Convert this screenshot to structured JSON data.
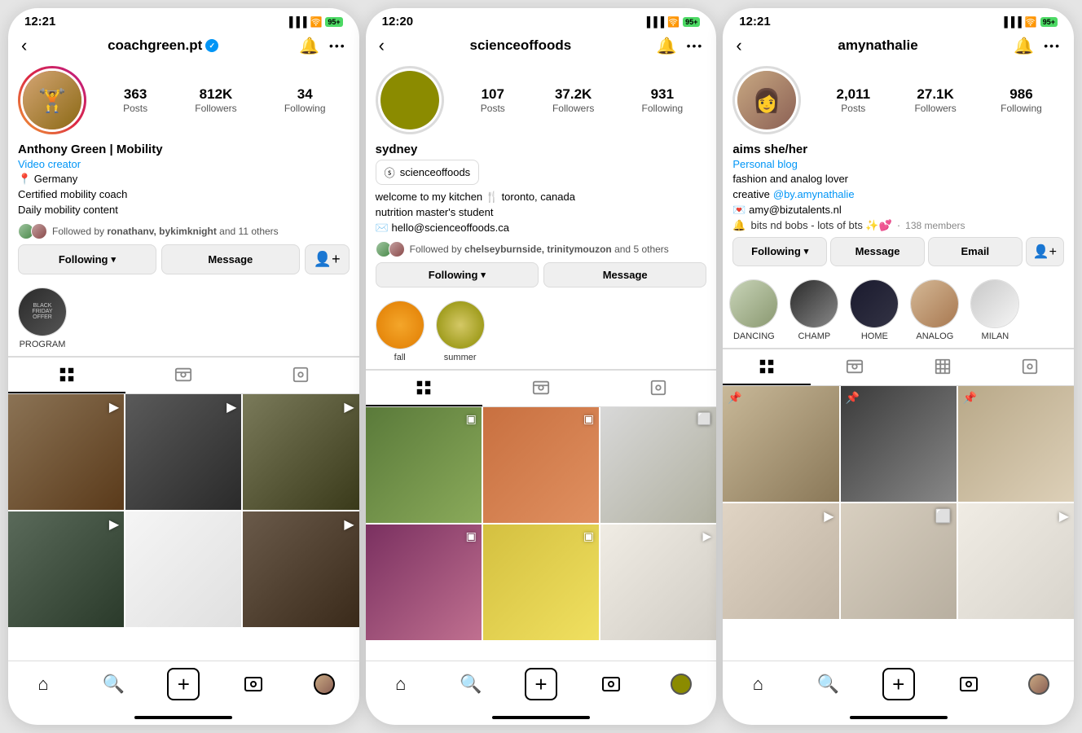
{
  "phones": [
    {
      "id": "coachgreen",
      "time": "12:21",
      "username": "coachgreen.pt",
      "verified": true,
      "stats": {
        "posts": "363",
        "posts_label": "Posts",
        "followers": "812K",
        "followers_label": "Followers",
        "following": "34",
        "following_label": "Following"
      },
      "name": "Anthony Green | Mobility",
      "bio_link": "Video creator",
      "bio_lines": [
        "📍 Germany",
        "Certified mobility coach",
        "Daily mobility content"
      ],
      "followed_by_text": "Followed by ronathanv, bykimknight and 11 others",
      "buttons": {
        "following": "Following",
        "message": "Message"
      },
      "highlights": [
        {
          "label": "PROGRAM"
        }
      ],
      "tab_active": "grid",
      "grid_cells": [
        {
          "bg": "cell-bg-1",
          "overlay": "▶"
        },
        {
          "bg": "cell-bg-2",
          "overlay": "▶"
        },
        {
          "bg": "cell-bg-3",
          "overlay": "▶"
        },
        {
          "bg": "cell-bg-4",
          "overlay": "▶"
        },
        {
          "bg": "cell-bg-5",
          "overlay": "▶"
        },
        {
          "bg": "cell-bg-6",
          "overlay": "▶"
        }
      ]
    },
    {
      "id": "scienceoffoods",
      "time": "12:20",
      "username": "scienceoffoods",
      "verified": false,
      "stats": {
        "posts": "107",
        "posts_label": "Posts",
        "followers": "37.2K",
        "followers_label": "Followers",
        "following": "931",
        "following_label": "Following"
      },
      "name": "sydney",
      "threads_handle": "scienceoffoods",
      "bio_lines": [
        "welcome to my kitchen 🍴 toronto, canada",
        "nutrition master's student",
        "✉️ hello@scienceoffoods.ca"
      ],
      "followed_by_text": "Followed by chelseyburnside, trinitymouzon and 5 others",
      "buttons": {
        "following": "Following",
        "message": "Message"
      },
      "highlights": [
        {
          "label": "fall",
          "bg": "hl-fall"
        },
        {
          "label": "summer",
          "bg": "hl-summer"
        }
      ],
      "tab_active": "grid",
      "grid_cells": [
        {
          "bg": "cell-food-1",
          "overlay": "📋"
        },
        {
          "bg": "cell-food-2",
          "overlay": "📋"
        },
        {
          "bg": "cell-food-3",
          "overlay": "⬜"
        },
        {
          "bg": "cell-food-4",
          "overlay": "📋"
        },
        {
          "bg": "cell-food-5",
          "overlay": "📋"
        },
        {
          "bg": "cell-food-6",
          "overlay": "▶"
        }
      ]
    },
    {
      "id": "amynathalie",
      "time": "12:21",
      "username": "amynathalie",
      "verified": false,
      "stats": {
        "posts": "2,011",
        "posts_label": "Posts",
        "followers": "27.1K",
        "followers_label": "Followers",
        "following": "986",
        "following_label": "Following"
      },
      "name": "aims she/her",
      "bio_link": "Personal blog",
      "bio_lines": [
        "fashion and analog lover",
        "creative @by.amynathalie",
        "💌 amy@bizutalents.nl"
      ],
      "subscription_text": "bits nd bobs - lots of bts ✨💕",
      "subscription_count": "138 members",
      "followed_by_text": "",
      "buttons": {
        "following": "Following",
        "message": "Message",
        "email": "Email"
      },
      "highlights": [
        {
          "label": "DANCING",
          "bg": "hl-dancing"
        },
        {
          "label": "CHAMP",
          "bg": "hl-champ"
        },
        {
          "label": "HOME",
          "bg": "hl-home"
        },
        {
          "label": "ANALOG",
          "bg": "hl-analog"
        },
        {
          "label": "MILAN",
          "bg": "hl-milan"
        }
      ],
      "tab_active": "grid",
      "grid_cells": [
        {
          "bg": "cell-amy-1",
          "overlay": "📌"
        },
        {
          "bg": "cell-amy-2",
          "overlay": "📌"
        },
        {
          "bg": "cell-amy-3",
          "overlay": "📌"
        },
        {
          "bg": "cell-amy-4",
          "overlay": "▶"
        },
        {
          "bg": "cell-amy-5",
          "overlay": "⬜"
        },
        {
          "bg": "cell-amy-6",
          "overlay": "▶"
        }
      ]
    }
  ],
  "nav": {
    "back": "‹",
    "bell": "🔔",
    "more": "•••"
  },
  "bottom_nav": {
    "home": "⌂",
    "search": "🔍",
    "add": "⊕",
    "reels": "▶",
    "profile": "👤"
  }
}
